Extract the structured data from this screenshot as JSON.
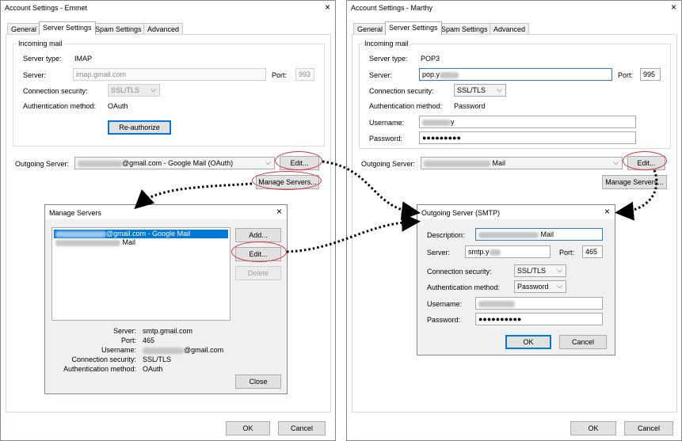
{
  "left_window": {
    "title": "Account Settings - Emmet",
    "tabs": [
      "General",
      "Server Settings",
      "Spam Settings",
      "Advanced"
    ],
    "incoming_group": "Incoming mail",
    "server_type_label": "Server type:",
    "server_type_value": "IMAP",
    "server_label": "Server:",
    "server_value": "imap.gmail.com",
    "port_label": "Port:",
    "port_value": "993",
    "conn_security_label": "Connection security:",
    "conn_security_value": "SSL/TLS",
    "auth_method_label": "Authentication method:",
    "auth_method_value": "OAuth",
    "reauthorize_label": "Re-authorize",
    "outgoing_label": "Outgoing Server:",
    "outgoing_value": "@gmail.com - Google Mail (OAuth)",
    "edit_label": "Edit...",
    "manage_servers_label": "Manage Servers...",
    "ok_label": "OK",
    "cancel_label": "Cancel"
  },
  "right_window": {
    "title": "Account Settings - Marthy",
    "tabs": [
      "General",
      "Server Settings",
      "Spam Settings",
      "Advanced"
    ],
    "incoming_group": "Incoming mail",
    "server_type_label": "Server type:",
    "server_type_value": "POP3",
    "server_label": "Server:",
    "server_value": "pop.y",
    "port_label": "Port:",
    "port_value": "995",
    "conn_security_label": "Connection security:",
    "conn_security_value": "SSL/TLS",
    "auth_method_label": "Authentication method:",
    "auth_method_value": "Password",
    "username_label": "Username:",
    "username_value": "y",
    "password_label": "Password:",
    "password_value": "●●●●●●●●●",
    "outgoing_label": "Outgoing Server:",
    "outgoing_value": "Mail",
    "edit_label": "Edit...",
    "manage_servers_label": "Manage Servers...",
    "ok_label": "OK",
    "cancel_label": "Cancel"
  },
  "manage_servers": {
    "title": "Manage Servers",
    "list": [
      "@gmail.com - Google Mail",
      "Mail"
    ],
    "add_label": "Add...",
    "edit_label": "Edit...",
    "delete_label": "Delete",
    "server_label": "Server:",
    "server_value": "smtp.gmail.com",
    "port_label": "Port:",
    "port_value": "465",
    "username_label": "Username:",
    "username_value": "@gmail.com",
    "conn_security_label": "Connection security:",
    "conn_security_value": "SSL/TLS",
    "auth_method_label": "Authentication method:",
    "auth_method_value": "OAuth",
    "close_label": "Close"
  },
  "smtp_dialog": {
    "title": "Outgoing Server (SMTP)",
    "description_label": "Description:",
    "description_value": "Mail",
    "server_label": "Server:",
    "server_value": "smtp.y",
    "port_label": "Port:",
    "port_value": "465",
    "conn_security_label": "Connection security:",
    "conn_security_value": "SSL/TLS",
    "auth_method_label": "Authentication method:",
    "auth_method_value": "Password",
    "username_label": "Username:",
    "password_label": "Password:",
    "password_value": "●●●●●●●●●●",
    "ok_label": "OK",
    "cancel_label": "Cancel"
  },
  "icons": {
    "close": "×",
    "chevron": "⌵"
  },
  "colors": {
    "highlight_oval": "#d9333f",
    "selection": "#0078d7",
    "focus_border": "#2d7bd6"
  }
}
